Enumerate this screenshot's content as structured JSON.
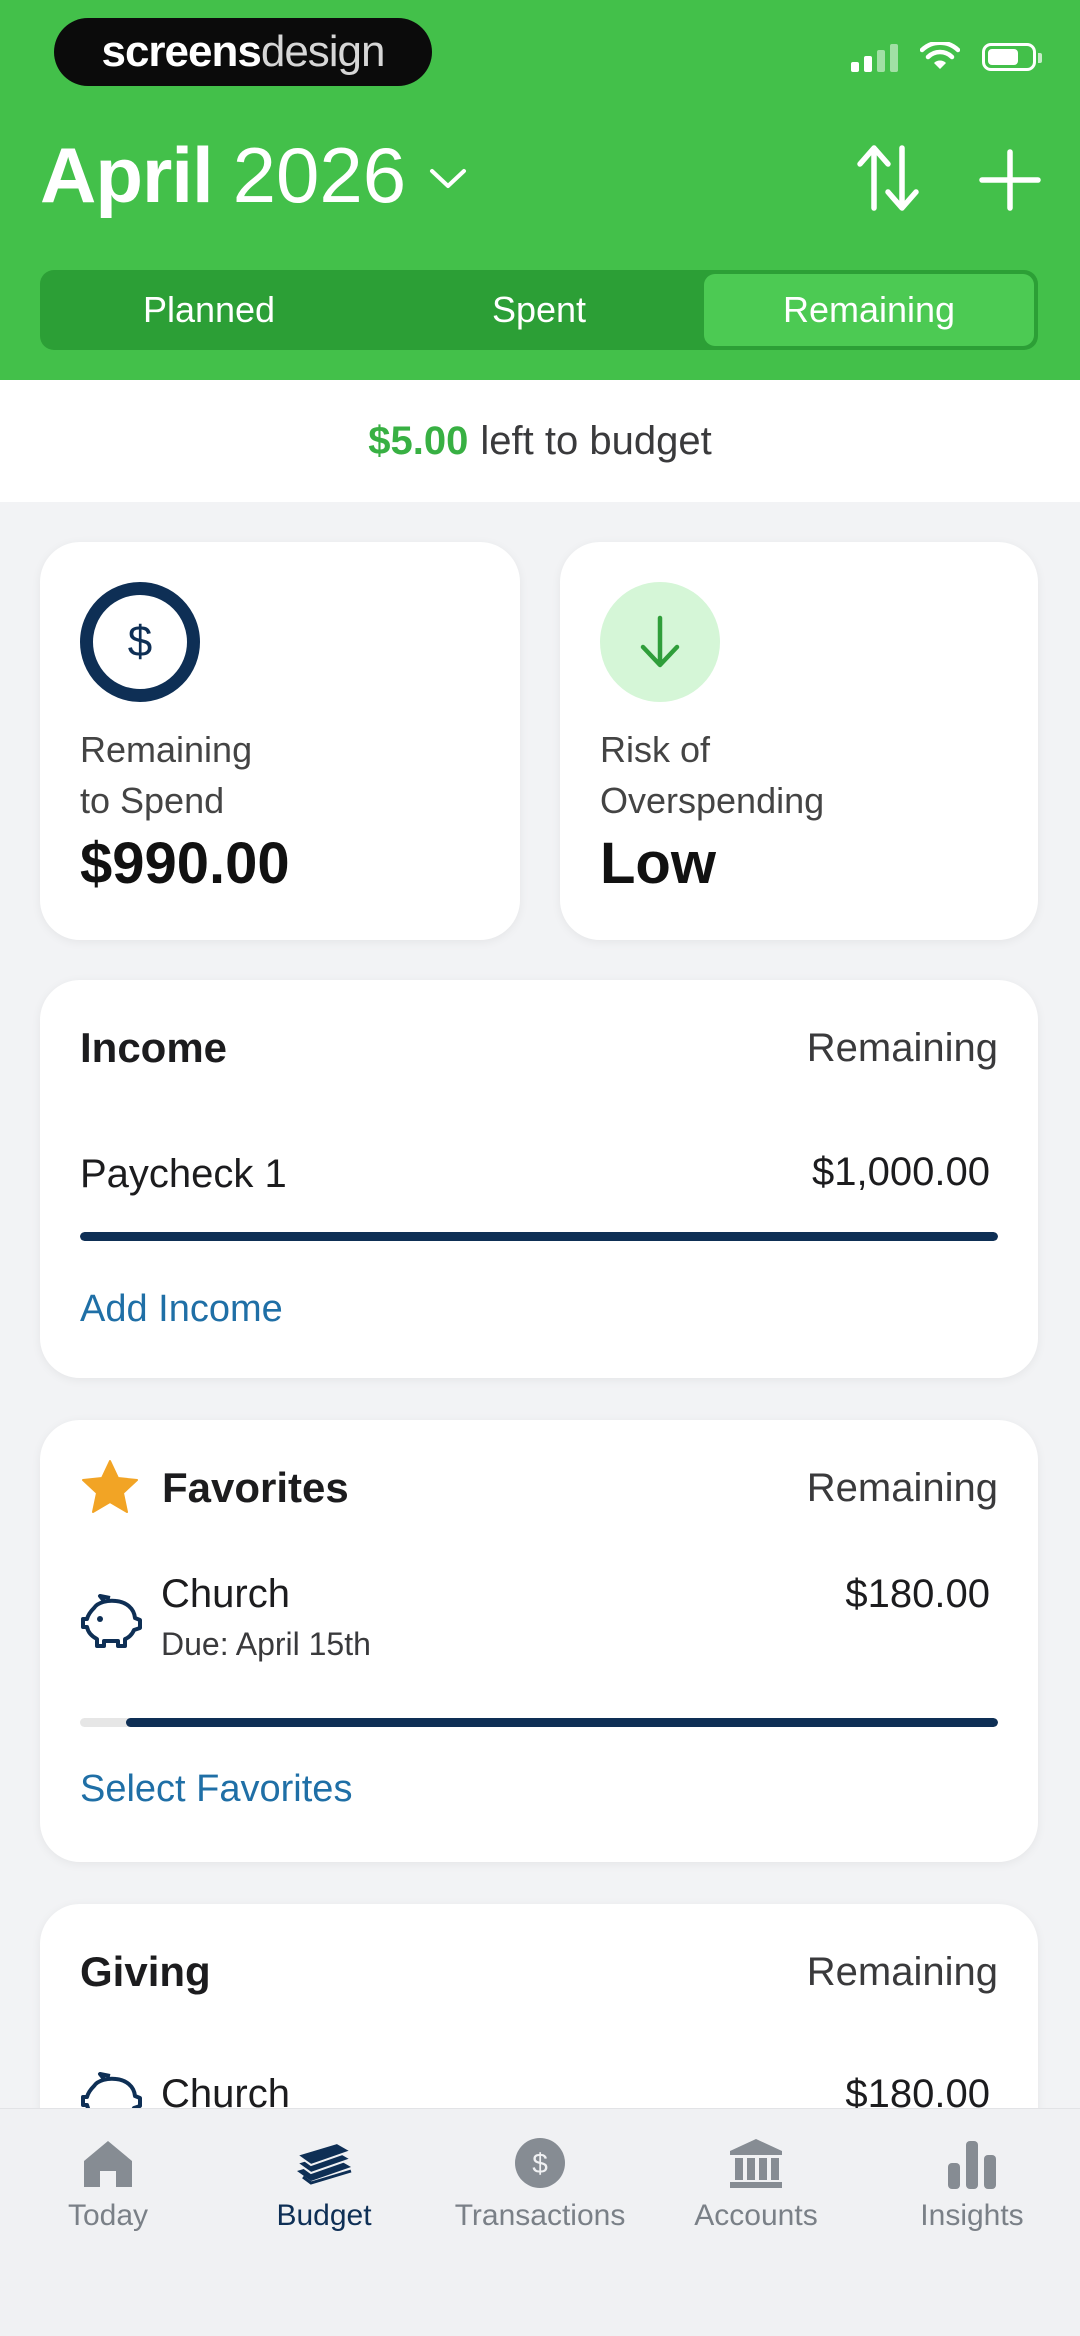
{
  "brand": {
    "part1": "screens",
    "part2": "design"
  },
  "header": {
    "month": "April",
    "year": "2026"
  },
  "tabs": [
    {
      "label": "Planned",
      "active": false
    },
    {
      "label": "Spent",
      "active": false
    },
    {
      "label": "Remaining",
      "active": true
    }
  ],
  "left_to_budget": {
    "amount": "$5.00",
    "text": "left to budget"
  },
  "stats": {
    "remaining": {
      "label_line1": "Remaining",
      "label_line2": "to Spend",
      "value": "$990.00",
      "icon": "dollar-ring-icon"
    },
    "risk": {
      "label_line1": "Risk of",
      "label_line2": "Overspending",
      "value": "Low",
      "icon": "arrow-down-icon"
    }
  },
  "income": {
    "title": "Income",
    "right": "Remaining",
    "items": [
      {
        "name": "Paycheck 1",
        "amount": "$1,000.00",
        "progress": 1.0
      }
    ],
    "link": "Add Income"
  },
  "favorites": {
    "title": "Favorites",
    "right": "Remaining",
    "items": [
      {
        "name": "Church",
        "due": "Due: April 15th",
        "amount": "$180.00",
        "progress": 0.95,
        "icon": "piggy-bank-icon"
      }
    ],
    "link": "Select Favorites"
  },
  "giving": {
    "title": "Giving",
    "right": "Remaining",
    "items": [
      {
        "name": "Church",
        "amount": "$180.00",
        "icon": "piggy-bank-icon"
      }
    ]
  },
  "tabbar": [
    {
      "label": "Today",
      "icon": "home-icon",
      "active": false
    },
    {
      "label": "Budget",
      "icon": "budget-stack-icon",
      "active": true
    },
    {
      "label": "Transactions",
      "icon": "dollar-circle-icon",
      "active": false
    },
    {
      "label": "Accounts",
      "icon": "bank-icon",
      "active": false
    },
    {
      "label": "Insights",
      "icon": "bar-chart-icon",
      "active": false
    }
  ],
  "colors": {
    "brand_green": "#43c04a",
    "navy": "#0e2f55",
    "link_blue": "#1f6fa6",
    "money_green": "#38b043"
  }
}
